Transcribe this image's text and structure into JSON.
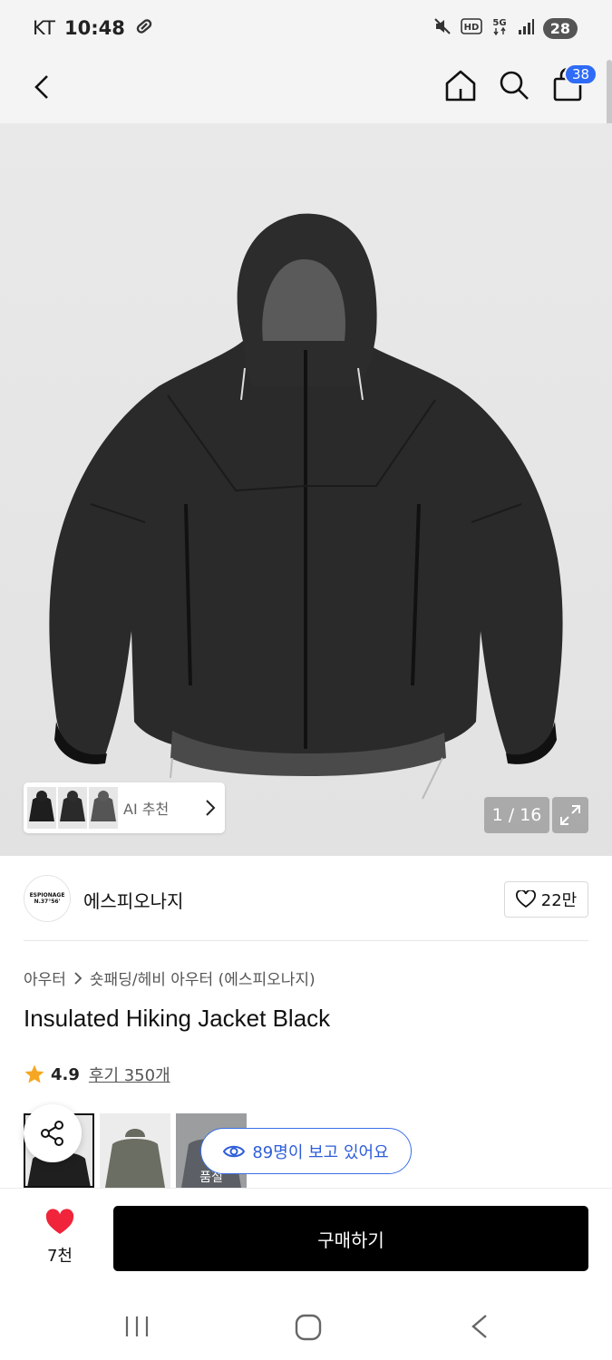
{
  "status_bar": {
    "carrier": "KT",
    "time": "10:48",
    "battery": "28"
  },
  "top_nav": {
    "cart_count": "38"
  },
  "hero": {
    "ai_recommend_label": "AI 추천",
    "page_counter": "1 / 16"
  },
  "brand": {
    "logo_text_top": "ESPIONAGE",
    "logo_text_bottom": "N.37°56'",
    "name": "에스피오나지",
    "likes": "22만"
  },
  "product": {
    "breadcrumb_category": "아우터",
    "breadcrumb_subcategory": "숏패딩/헤비 아우터 (에스피오나지)",
    "title": "Insulated Hiking Jacket Black",
    "rating": "4.9",
    "reviews": "후기 350개"
  },
  "variants": {
    "soldout_label": "품절"
  },
  "viewing": {
    "label": "89명이 보고 있어요"
  },
  "bottom_bar": {
    "wish_count": "7천",
    "buy_label": "구매하기"
  },
  "colors": {
    "accent_blue": "#2e6bf6",
    "heart_red": "#f0243a",
    "star_orange": "#f5a623",
    "buy_button": "#000000"
  }
}
